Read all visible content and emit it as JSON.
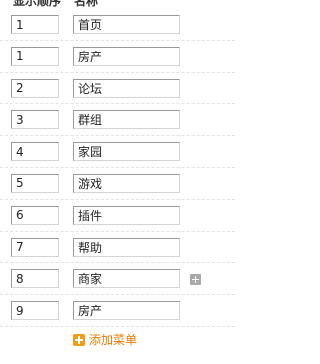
{
  "header": {
    "order_label": "显示顺序",
    "name_label": "名称"
  },
  "menu_items": [
    {
      "order": "1",
      "name": "首页"
    },
    {
      "order": "1",
      "name": "房产"
    },
    {
      "order": "2",
      "name": "论坛"
    },
    {
      "order": "3",
      "name": "群组"
    },
    {
      "order": "4",
      "name": "家园"
    },
    {
      "order": "5",
      "name": "游戏"
    },
    {
      "order": "6",
      "name": "插件"
    },
    {
      "order": "7",
      "name": "帮助"
    },
    {
      "order": "8",
      "name": "商家",
      "has_submenu_button": true
    },
    {
      "order": "9",
      "name": "房产"
    }
  ],
  "add_menu": {
    "label": "添加菜单"
  }
}
